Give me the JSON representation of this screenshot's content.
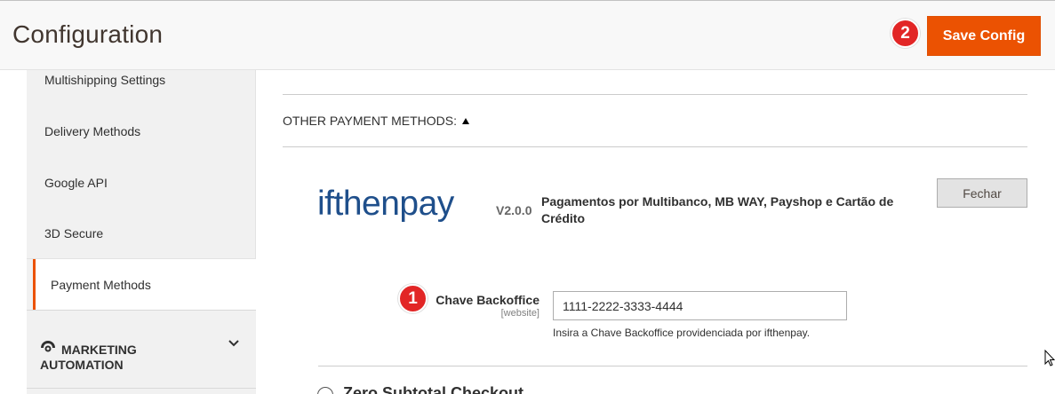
{
  "header": {
    "title": "Configuration",
    "save_label": "Save Config",
    "badge_save": "2"
  },
  "sidebar": {
    "items": [
      {
        "label": "Multishipping Settings"
      },
      {
        "label": "Delivery Methods"
      },
      {
        "label": "Google API"
      },
      {
        "label": "3D Secure"
      },
      {
        "label": "Payment Methods",
        "active": true
      }
    ],
    "section": {
      "title": "MARKETING AUTOMATION",
      "icon": "marketing-automation-icon",
      "chevron": "chevron-down-icon"
    }
  },
  "content": {
    "group_title": "OTHER PAYMENT METHODS:",
    "plugin": {
      "logo_text": "ifthenpay",
      "version": "V2.0.0",
      "description": "Pagamentos por Multibanco, MB WAY, Payshop e Cartão de Crédito",
      "close_label": "Fechar"
    },
    "field": {
      "badge": "1",
      "label": "Chave Backoffice",
      "scope": "[website]",
      "value": "1111-2222-3333-4444",
      "note": "Insira a Chave Backoffice providenciada por ifthenpay."
    },
    "next_section": "Zero Subtotal Checkout"
  },
  "colors": {
    "accent": "#eb5202",
    "badge": "#e22626",
    "logo_blue": "#1f4f8b"
  }
}
